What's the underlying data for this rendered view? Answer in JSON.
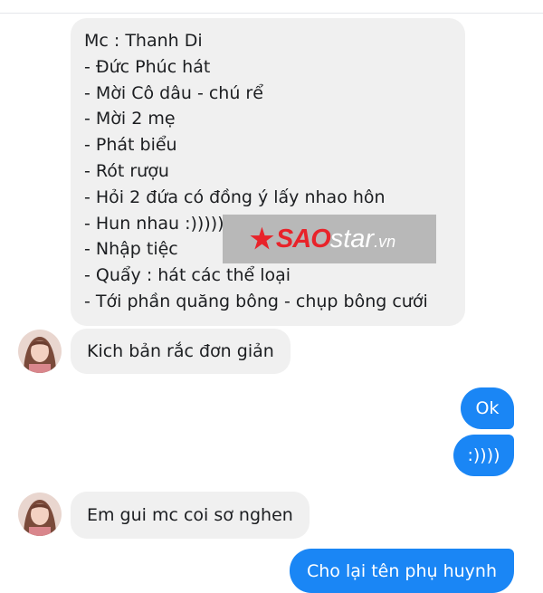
{
  "script_message": {
    "lines": [
      "Mc : Thanh Di",
      "- Đức Phúc hát",
      "- Mời  Cô dâu - chú rể",
      "- Mời 2 mẹ",
      "- Phát biểu",
      "- Rót rượu",
      "- Hỏi 2 đứa có đồng ý lấy nhao hôn",
      "- Hun nhau :)))))",
      "- Nhập tiệc",
      "- Quẩy : hát các thể loại",
      "- Tới phần quăng bông - chụp bông cưới"
    ]
  },
  "messages": [
    {
      "side": "incoming",
      "text": "Kich bản rắc đơn giản"
    },
    {
      "side": "outgoing",
      "text": "Ok"
    },
    {
      "side": "outgoing",
      "text": ":))))"
    },
    {
      "side": "incoming",
      "text": "Em gui mc coi sơ nghen"
    },
    {
      "side": "outgoing",
      "text": "Cho lại tên phụ huynh"
    }
  ],
  "watermark": {
    "star_icon": "star-icon",
    "brand_red": "SAO",
    "brand_white": "star",
    "suffix": ".vn"
  },
  "colors": {
    "outgoing_bubble": "#1a86f5",
    "incoming_bubble": "#f0f0f0",
    "watermark_red": "#e8232a"
  }
}
